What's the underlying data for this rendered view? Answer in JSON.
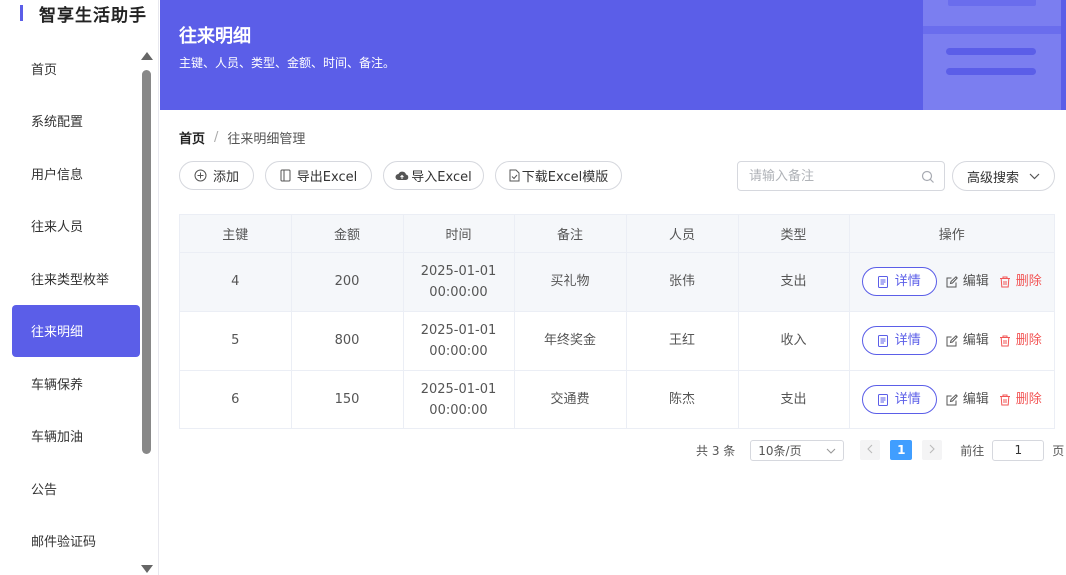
{
  "app": {
    "title": "智享生活助手",
    "brand_color": "#5b5ee8"
  },
  "sidebar": {
    "items": [
      {
        "label": "首页",
        "active": false
      },
      {
        "label": "系统配置",
        "active": false
      },
      {
        "label": "用户信息",
        "active": false
      },
      {
        "label": "往来人员",
        "active": false
      },
      {
        "label": "往来类型枚举",
        "active": false
      },
      {
        "label": "往来明细",
        "active": true
      },
      {
        "label": "车辆保养",
        "active": false
      },
      {
        "label": "车辆加油",
        "active": false
      },
      {
        "label": "公告",
        "active": false
      },
      {
        "label": "邮件验证码",
        "active": false
      }
    ]
  },
  "header": {
    "title": "往来明细",
    "subtitle": "主键、人员、类型、金额、时间、备注。",
    "icon": "folder-icon"
  },
  "breadcrumb": {
    "home": "首页",
    "separator": "/",
    "current": "往来明细管理"
  },
  "toolbar": {
    "add_label": "添加",
    "export_label": "导出Excel",
    "import_label": "导入Excel",
    "template_label": "下载Excel模版"
  },
  "search": {
    "placeholder": "请输入备注",
    "value": "",
    "advanced_label": "高级搜索"
  },
  "table": {
    "columns": [
      "主键",
      "金额",
      "时间",
      "备注",
      "人员",
      "类型",
      "操作"
    ],
    "rows": [
      {
        "id": "4",
        "amount": "200",
        "date": "2025-01-01",
        "time": "00:00:00",
        "note": "买礼物",
        "person": "张伟",
        "type": "支出"
      },
      {
        "id": "5",
        "amount": "800",
        "date": "2025-01-01",
        "time": "00:00:00",
        "note": "年终奖金",
        "person": "王红",
        "type": "收入"
      },
      {
        "id": "6",
        "amount": "150",
        "date": "2025-01-01",
        "time": "00:00:00",
        "note": "交通费",
        "person": "陈杰",
        "type": "支出"
      }
    ],
    "actions": {
      "detail": "详情",
      "edit": "编辑",
      "delete": "删除"
    }
  },
  "pagination": {
    "total_label": "共 3 条",
    "page_size": "10条/页",
    "current_page": "1",
    "goto_label": "前往",
    "goto_value": "1",
    "page_unit": "页"
  },
  "colors": {
    "primary": "#5b5ee8",
    "danger": "#f25555",
    "pager_active": "#409eff"
  }
}
